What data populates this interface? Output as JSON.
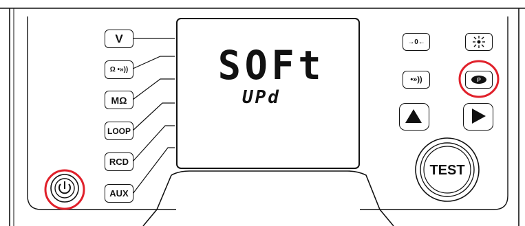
{
  "display": {
    "main_text": "SOFt",
    "sub_text": "UPd"
  },
  "function_buttons": {
    "voltage": "V",
    "continuity": "Ω •»))",
    "insulation": "MΩ",
    "loop": "LOOP",
    "rcd": "RCD",
    "aux": "AUX"
  },
  "right_buttons": {
    "zero": "→0←",
    "buzzer": "•»))",
    "test": "TEST"
  },
  "icons": {
    "power": "power-icon",
    "backlight": "backlight-icon",
    "parameter": "parameter-icon",
    "up": "triangle-up-icon",
    "right": "triangle-right-icon"
  },
  "highlight_color": "#e0202a"
}
